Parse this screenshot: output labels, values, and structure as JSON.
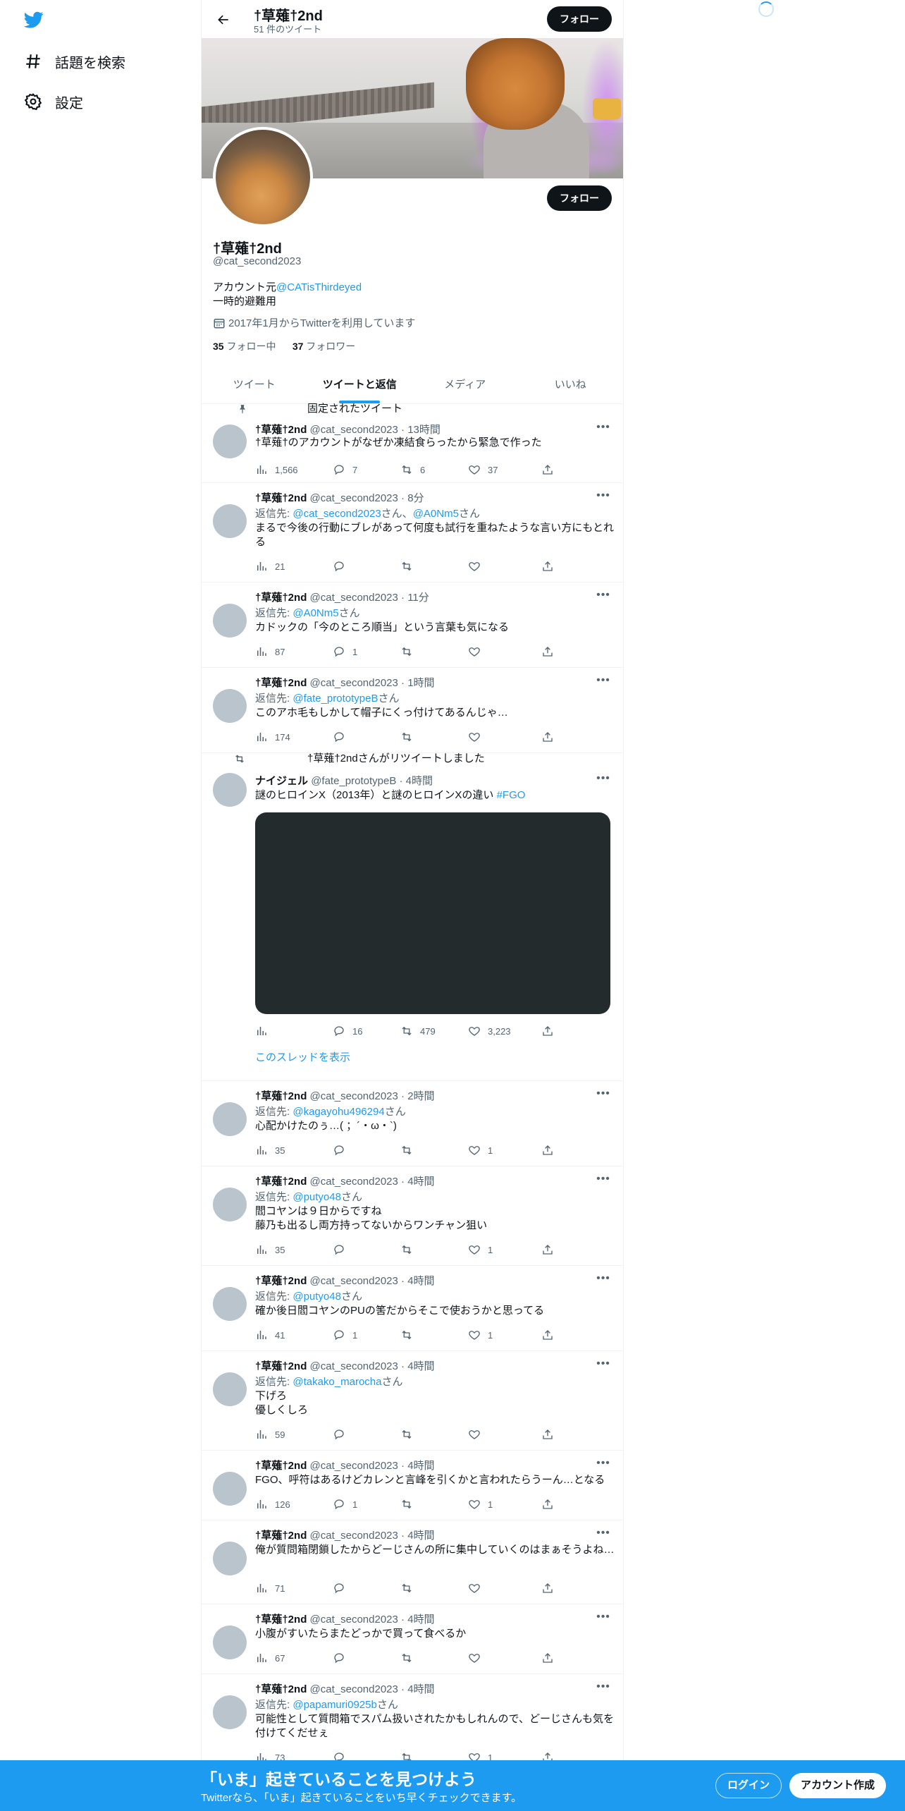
{
  "colors": {
    "accent": "#1d9bf0",
    "text": "#0f1419",
    "muted": "#536471",
    "button": "#0f1419"
  },
  "nav": {
    "logo_icon": "twitter-bird-icon",
    "items": [
      {
        "icon": "hashtag-icon",
        "label": "話題を検索"
      },
      {
        "icon": "gear-icon",
        "label": "設定"
      }
    ]
  },
  "header": {
    "name": "†草薙†2nd",
    "tweet_count": "51 件のツイート",
    "follow_label": "フォロー"
  },
  "profile": {
    "name": "†草薙†2nd",
    "handle": "@cat_second2023",
    "bio_prefix": "アカウント元",
    "bio_link": "@CATisThirdeyed",
    "bio_line2": "一時的避難用",
    "joined": "2017年1月からTwitterを利用しています",
    "following_count": "35",
    "following_label": "フォロー中",
    "followers_count": "37",
    "followers_label": "フォロワー",
    "follow_label": "フォロー"
  },
  "tabs": [
    {
      "label": "ツイート",
      "active": false
    },
    {
      "label": "ツイートと返信",
      "active": true
    },
    {
      "label": "メディア",
      "active": false
    },
    {
      "label": "いいね",
      "active": false
    }
  ],
  "tweets": [
    {
      "social": "固定されたツイート",
      "name": "†草薙†2nd",
      "handle": "@cat_second2023",
      "time": "13時間",
      "text": "†草薙†のアカウントがなぜか凍結食らったから緊急で作った",
      "views": "1,566",
      "replies": "7",
      "retweets": "6",
      "likes": "37"
    },
    {
      "name": "†草薙†2nd",
      "handle": "@cat_second2023",
      "time": "8分",
      "reply_prefix": "返信先: ",
      "reply_to": "@cat_second2023",
      "reply_mid": "さん、",
      "reply_to2": "@A0Nm5",
      "reply_suffix": "さん",
      "text": "まるで今後の行動にブレがあって何度も試行を重ねたような言い方にもとれる",
      "views": "21",
      "replies": "",
      "retweets": "",
      "likes": ""
    },
    {
      "name": "†草薙†2nd",
      "handle": "@cat_second2023",
      "time": "11分",
      "reply_prefix": "返信先: ",
      "reply_to": "@A0Nm5",
      "reply_suffix": "さん",
      "text": "カドックの「今のところ順当」という言葉も気になる",
      "views": "87",
      "replies": "1",
      "retweets": "",
      "likes": ""
    },
    {
      "name": "†草薙†2nd",
      "handle": "@cat_second2023",
      "time": "1時間",
      "reply_prefix": "返信先: ",
      "reply_to": "@fate_prototypeB",
      "reply_suffix": "さん",
      "text": "このアホ毛もしかして帽子にくっ付けてあるんじゃ…",
      "views": "174",
      "replies": "",
      "retweets": "",
      "likes": ""
    },
    {
      "social": "†草薙†2ndさんがリツイートしました",
      "name": "ナイジェル",
      "handle": "@fate_prototypeB",
      "time": "4時間",
      "text": "謎のヒロインX（2013年）と謎のヒロインXの違い ",
      "hashtag": "#FGO",
      "views": "",
      "replies": "16",
      "retweets": "479",
      "likes": "3,223",
      "thread_link": "このスレッドを表示"
    },
    {
      "name": "†草薙†2nd",
      "handle": "@cat_second2023",
      "time": "2時間",
      "reply_prefix": "返信先: ",
      "reply_to": "@kagayohu496294",
      "reply_suffix": "さん",
      "text": "心配かけたのぅ…( ；´・ω・`)",
      "views": "35",
      "replies": "",
      "retweets": "",
      "likes": "1"
    },
    {
      "name": "†草薙†2nd",
      "handle": "@cat_second2023",
      "time": "4時間",
      "reply_prefix": "返信先: ",
      "reply_to": "@putyo48",
      "reply_suffix": "さん",
      "text": "閻コヤンは９日からですね\n藤乃も出るし両方持ってないからワンチャン狙い",
      "views": "35",
      "replies": "",
      "retweets": "",
      "likes": "1"
    },
    {
      "name": "†草薙†2nd",
      "handle": "@cat_second2023",
      "time": "4時間",
      "reply_prefix": "返信先: ",
      "reply_to": "@putyo48",
      "reply_suffix": "さん",
      "text": "確か後日閻コヤンのPUの筈だからそこで使おうかと思ってる",
      "views": "41",
      "replies": "1",
      "retweets": "",
      "likes": "1"
    },
    {
      "name": "†草薙†2nd",
      "handle": "@cat_second2023",
      "time": "4時間",
      "reply_prefix": "返信先: ",
      "reply_to": "@takako_marocha",
      "reply_suffix": "さん",
      "text": "下げろ\n優しくしろ",
      "views": "59",
      "replies": "",
      "retweets": "",
      "likes": ""
    },
    {
      "name": "†草薙†2nd",
      "handle": "@cat_second2023",
      "time": "4時間",
      "text": "FGO、呼符はあるけどカレンと言峰を引くかと言われたらうーん…となる",
      "views": "126",
      "replies": "1",
      "retweets": "",
      "likes": "1"
    },
    {
      "name": "†草薙†2nd",
      "handle": "@cat_second2023",
      "time": "4時間",
      "text": "俺が質問箱閉鎖したからどーじさんの所に集中していくのはまぁそうよね…",
      "views": "71",
      "replies": "",
      "retweets": "",
      "likes": ""
    },
    {
      "name": "†草薙†2nd",
      "handle": "@cat_second2023",
      "time": "4時間",
      "text": "小腹がすいたらまたどっかで買って食べるか",
      "views": "67",
      "replies": "",
      "retweets": "",
      "likes": ""
    },
    {
      "name": "†草薙†2nd",
      "handle": "@cat_second2023",
      "time": "4時間",
      "reply_prefix": "返信先: ",
      "reply_to": "@papamuri0925b",
      "reply_suffix": "さん",
      "text": "可能性として質問箱でスパム扱いされたかもしれんので、どーじさんも気を付けてくだせぇ",
      "views": "73",
      "replies": "",
      "retweets": "",
      "likes": "1"
    }
  ],
  "bottom_bar": {
    "title": "「いま」起きていることを見つけよう",
    "subtitle": "Twitterなら、「いま」起きていることをいち早くチェックできます。",
    "login": "ログイン",
    "signup": "アカウント作成"
  }
}
